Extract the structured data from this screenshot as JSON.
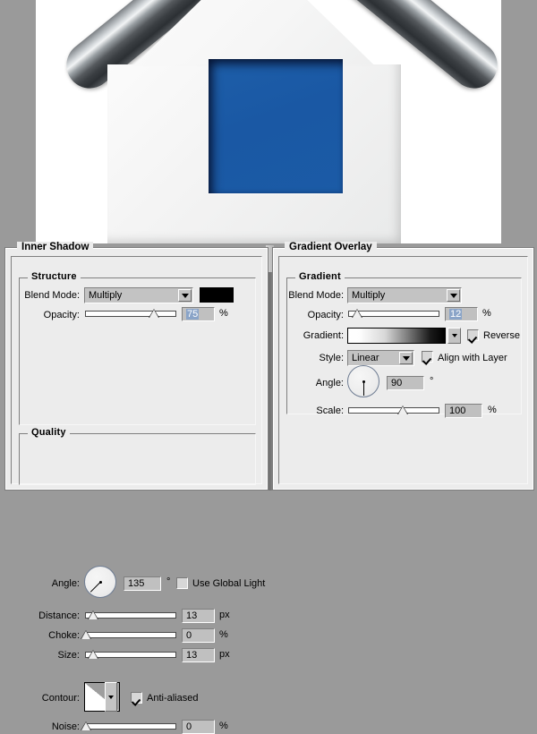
{
  "artwork": {
    "name": "house-icon-preview",
    "window_color": "#1b59a5",
    "roof_color": "#3a3e42",
    "body_color": "#f2f2f2"
  },
  "panels": [
    {
      "id": "inner-shadow",
      "title": "Inner Shadow",
      "groups": [
        {
          "id": "structure",
          "title": "Structure",
          "rows": {
            "blend_mode": {
              "label": "Blend Mode:",
              "value": "Multiply",
              "swatch_color": "#000000"
            },
            "opacity": {
              "label": "Opacity:",
              "value": "75",
              "unit": "%",
              "slider_pct": 75,
              "selected": true
            },
            "angle": {
              "label": "Angle:",
              "value": "135",
              "unit": "°",
              "dial_degrees": 135,
              "use_global_light_label": "Use Global Light",
              "use_global_light_checked": false
            },
            "distance": {
              "label": "Distance:",
              "value": "13",
              "unit": "px",
              "slider_pct": 9
            },
            "choke": {
              "label": "Choke:",
              "value": "0",
              "unit": "%",
              "slider_pct": 0
            },
            "size": {
              "label": "Size:",
              "value": "13",
              "unit": "px",
              "slider_pct": 9
            }
          }
        },
        {
          "id": "quality",
          "title": "Quality",
          "rows": {
            "contour": {
              "label": "Contour:",
              "anti_aliased_label": "Anti-aliased",
              "anti_aliased_checked": true
            },
            "noise": {
              "label": "Noise:",
              "value": "0",
              "unit": "%",
              "slider_pct": 0
            }
          }
        }
      ]
    },
    {
      "id": "gradient-overlay",
      "title": "Gradient Overlay",
      "groups": [
        {
          "id": "gradient",
          "title": "Gradient",
          "rows": {
            "blend_mode": {
              "label": "Blend Mode:",
              "value": "Multiply"
            },
            "opacity": {
              "label": "Opacity:",
              "value": "12",
              "unit": "%",
              "slider_pct": 10,
              "selected": true
            },
            "gradient": {
              "label": "Gradient:",
              "reverse_label": "Reverse",
              "reverse_checked": true,
              "from_color": "#ffffff",
              "to_color": "#000000"
            },
            "style": {
              "label": "Style:",
              "value": "Linear",
              "align_label": "Align with Layer",
              "align_checked": true
            },
            "angle": {
              "label": "Angle:",
              "value": "90",
              "unit": "°",
              "dial_degrees": 90
            },
            "scale": {
              "label": "Scale:",
              "value": "100",
              "unit": "%",
              "slider_pct": 60
            }
          }
        }
      ]
    }
  ]
}
